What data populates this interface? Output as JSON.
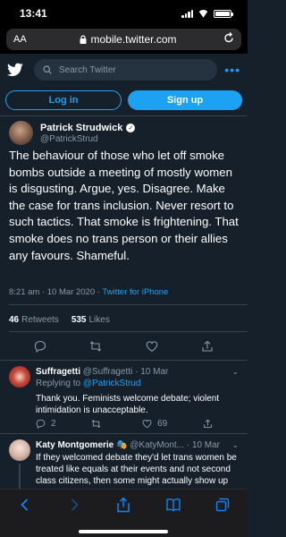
{
  "status_bar": {
    "time": "13:41"
  },
  "browser": {
    "text_size_label": "AA",
    "url": "mobile.twitter.com"
  },
  "twitter": {
    "search_placeholder": "Search Twitter",
    "login_label": "Log in",
    "signup_label": "Sign up"
  },
  "tweet": {
    "author_name": "Patrick Strudwick",
    "author_handle": "@PatrickStrud",
    "text": "The behaviour of those who let off smoke bombs outside a meeting of mostly women is disgusting. Argue, yes. Disagree. Make the case for trans inclusion. Never resort to such tactics. That smoke is frightening. That smoke does no trans person or their allies any favours. Shameful.",
    "timestamp": "8:21 am · 10 Mar 2020 · ",
    "source": "Twitter for iPhone",
    "retweets_count": "46",
    "retweets_label": "Retweets",
    "likes_count": "535",
    "likes_label": "Likes"
  },
  "replies": [
    {
      "name": "Suffragetti",
      "handle": "@Suffragetti · 10 Mar",
      "replying_to_prefix": "Replying to ",
      "replying_to": "@PatrickStrud",
      "text": "Thank you. Feminists welcome debate; violent intimidation is unacceptable.",
      "reply_count": "2",
      "retweet_count": "",
      "like_count": "69"
    },
    {
      "name": "Katy Montgomerie",
      "emoji": "🎭",
      "handle": "@KatyMont... · 10 Mar",
      "text": "If they welcomed debate they'd let trans women be treated like equals at their events and not second class citizens, then some might actually show up"
    }
  ],
  "colors": {
    "background": "#15202b",
    "accent": "#1da1f2",
    "muted": "#8899a6",
    "ios_blue": "#0a84ff"
  }
}
